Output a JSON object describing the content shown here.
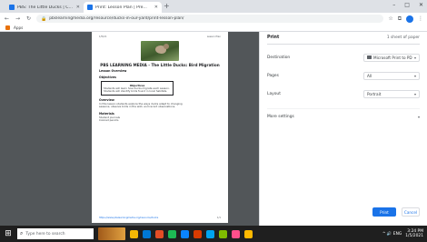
{
  "browser": {
    "tabs": [
      {
        "title": "PBS: The Little Ducks | Clas...",
        "favicon_color": "#1a73e8"
      },
      {
        "title": "Print: Lesson Plan | Pre...",
        "favicon_color": "#1a73e8"
      }
    ],
    "new_tab_label": "+",
    "window_controls": [
      "–",
      "□",
      "✕"
    ],
    "url": "pbslearningmedia.org/resource/ducks-in-our-yard/print-lesson-plan/",
    "bookmarks": [
      {
        "label": "Apps"
      }
    ]
  },
  "preview": {
    "page_header_left": "1/5/21",
    "page_header_right": "Lesson Plan",
    "title": "PBS LEARNING MEDIA - The Little Ducks: Bird Migration",
    "subtitle": "Lesson Overview",
    "sections": [
      {
        "heading": "Objectives",
        "box_title": "Objectives",
        "box_lines": [
          "Students will learn how ducks migrate each season.",
          "Students will identify birds found in local habitats."
        ]
      },
      {
        "heading": "Overview",
        "lines": [
          "In this lesson students explore the ways ducks adapt to changing",
          "seasons, observe birds in the wild, and record observations."
        ]
      },
      {
        "heading": "Materials",
        "lines": [
          "Student journals",
          "Colored pencils"
        ]
      }
    ],
    "footer_left": "https://www.pbslearningmedia.org/resource/ducks",
    "footer_right": "1/1"
  },
  "panel": {
    "title": "Print",
    "sheet_count": "1 sheet of paper",
    "rows": [
      {
        "label": "Destination",
        "value": "Microsoft Print to PDF",
        "icon": "printer-icon"
      },
      {
        "label": "Pages",
        "value": "All"
      },
      {
        "label": "Layout",
        "value": "Portrait"
      }
    ],
    "more_settings": "More settings",
    "primary_button": "Print",
    "secondary_button": "Cancel"
  },
  "taskbar": {
    "search_placeholder": "Type here to search",
    "apps": [
      "#f2b705",
      "#0078d4",
      "#e44d26",
      "#1db954",
      "#0a84ff",
      "#d83b01",
      "#00a4ef",
      "#7fba00",
      "#ff4f8b",
      "#ffb900"
    ],
    "tray_text": "^ 🔊 ENG",
    "time": "3:24 PM",
    "date": "1/5/2021"
  }
}
